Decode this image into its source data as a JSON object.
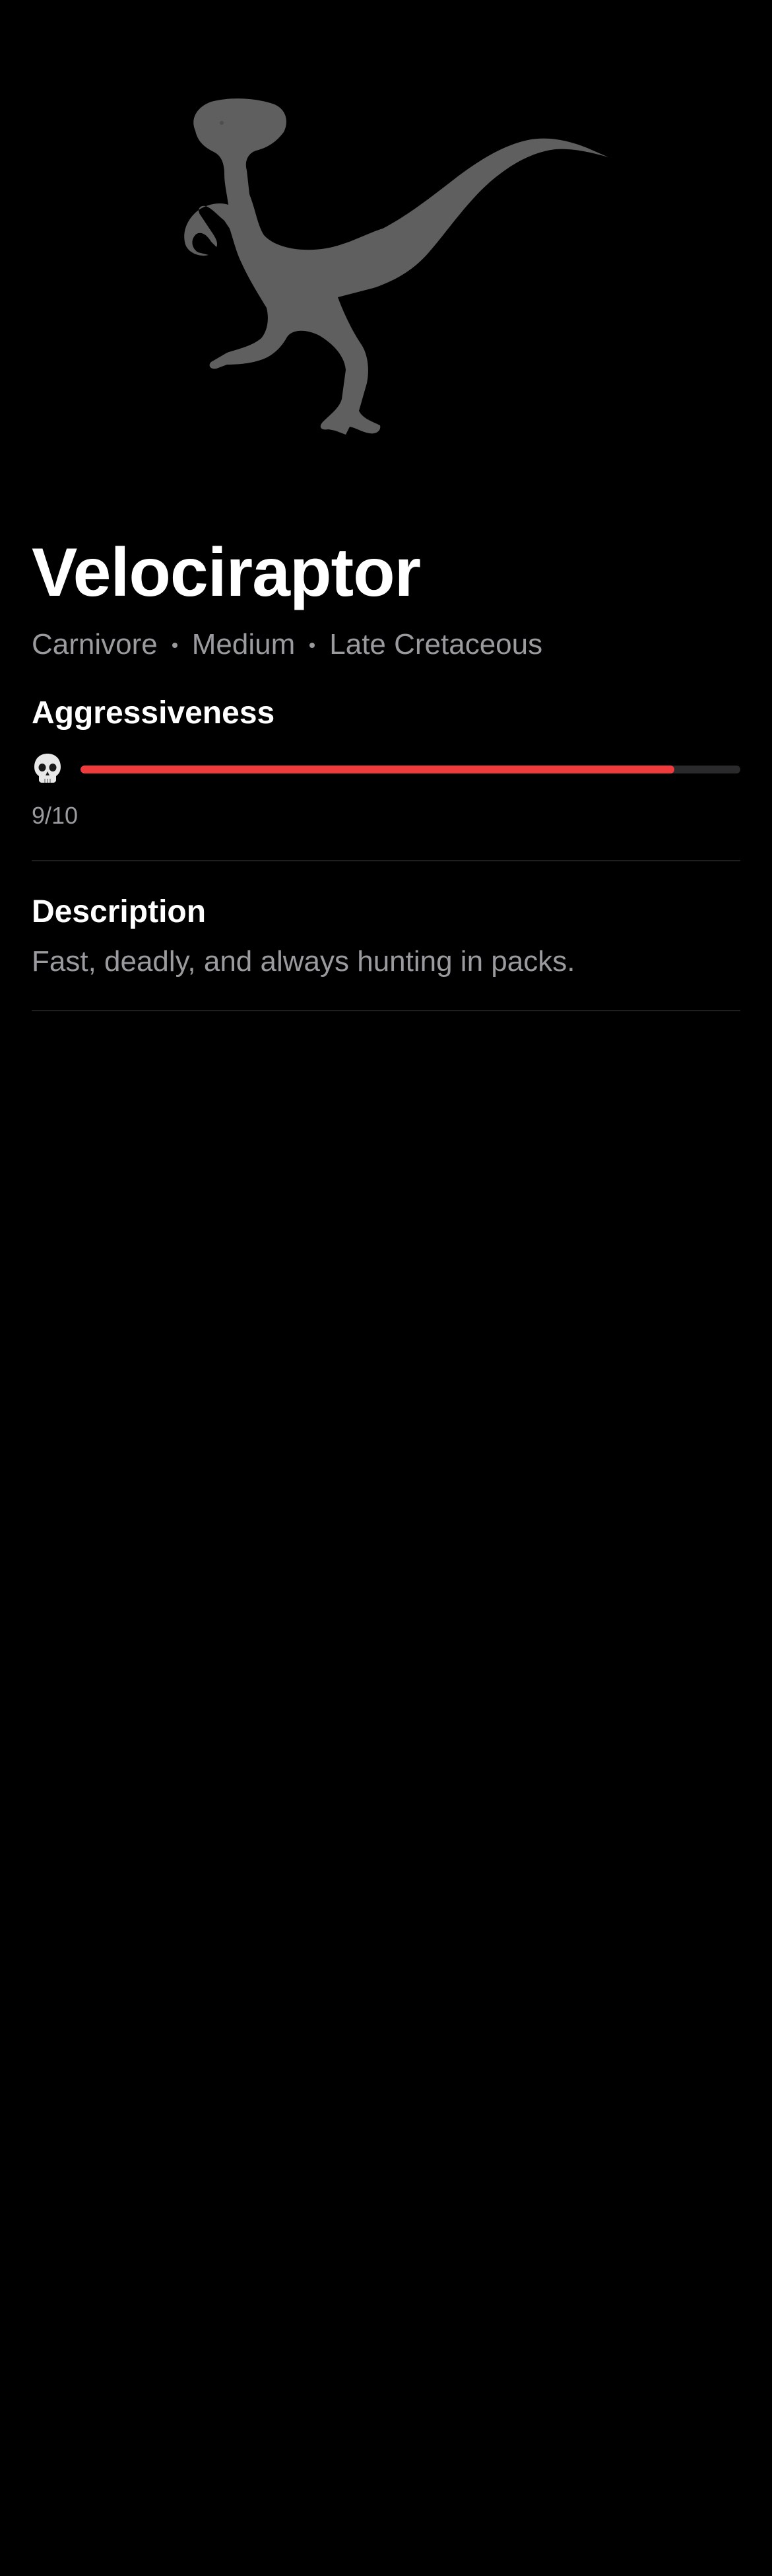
{
  "dinosaur": {
    "image_icon": "velociraptor-silhouette-icon",
    "name": "Velociraptor",
    "tags": [
      "Carnivore",
      "Medium",
      "Late Cretaceous"
    ]
  },
  "aggressiveness": {
    "heading": "Aggressiveness",
    "icon": "skull-icon",
    "value": 9,
    "max": 10,
    "label": "9/10",
    "bar_color": "#ef3b3b",
    "track_color": "#2a2a2c"
  },
  "description": {
    "heading": "Description",
    "text": "Fast, deadly, and always hunting in packs."
  },
  "colors": {
    "background": "#000000",
    "silhouette": "#5f5f5f",
    "secondary_text": "#9a9a9f"
  }
}
